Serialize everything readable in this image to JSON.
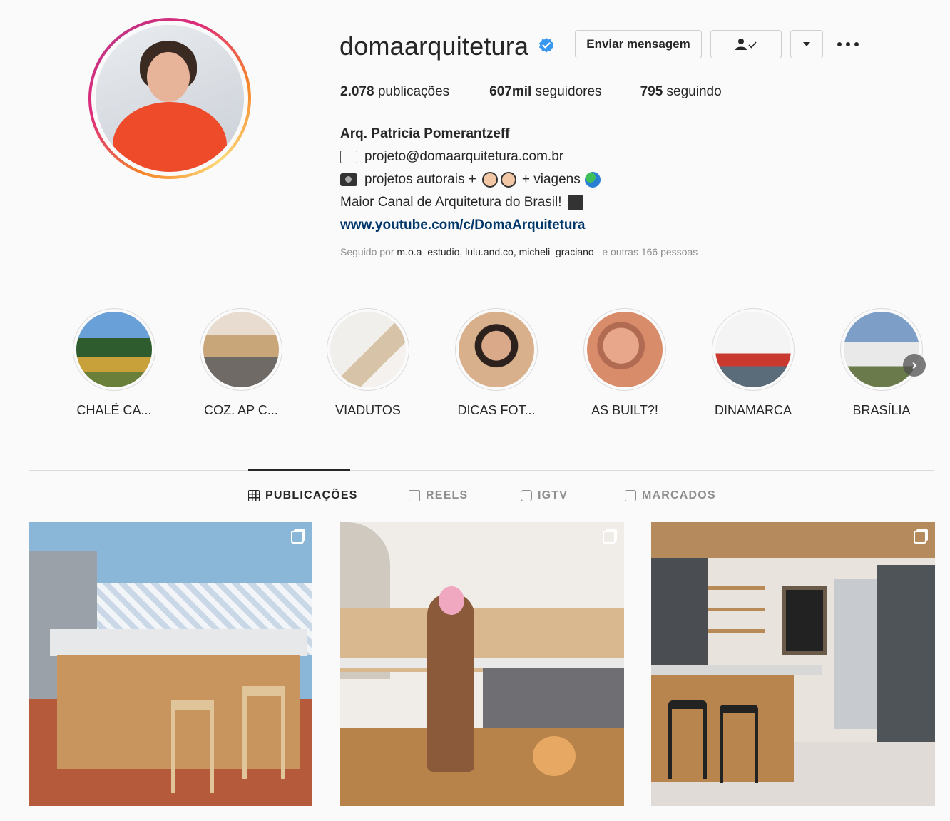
{
  "profile": {
    "username": "domaarquitetura",
    "verified": true,
    "buttons": {
      "message": "Enviar mensagem",
      "following_icon": "person-check-icon",
      "dropdown_icon": "chevron-down-icon",
      "more_icon": "more-options-icon"
    },
    "stats": {
      "posts_value": "2.078",
      "posts_label": "publicações",
      "followers_value": "607mil",
      "followers_label": "seguidores",
      "following_value": "795",
      "following_label": "seguindo"
    },
    "bio": {
      "name": "Arq. Patricia Pomerantzeff",
      "email": "projeto@domaarquitetura.com.br",
      "line2_a": "projetos autorais +",
      "line2_b": "+ viagens",
      "line3": "Maior Canal de Arquitetura do Brasil!",
      "link": "www.youtube.com/c/DomaArquitetura"
    },
    "followed_by": {
      "prefix": "Seguido por",
      "users": "m.o.a_estudio, lulu.and.co, micheli_graciano_",
      "suffix": "e outras 166 pessoas"
    }
  },
  "highlights": [
    {
      "label": "CHALÉ CA...",
      "color": "#3a6b3a"
    },
    {
      "label": "COZ. AP C...",
      "color": "#c9a57a"
    },
    {
      "label": "VIADUTOS",
      "color": "#e9e6e2"
    },
    {
      "label": "DICAS FOT...",
      "color": "#d9b08c"
    },
    {
      "label": "AS BUILT?!",
      "color": "#d98c6a"
    },
    {
      "label": "DINAMARCA",
      "color": "#c9392f"
    },
    {
      "label": "BRASÍLIA",
      "color": "#8aa6c8"
    }
  ],
  "tabs": [
    {
      "label": "PUBLICAÇÕES",
      "icon": "grid-icon",
      "active": true
    },
    {
      "label": "REELS",
      "icon": "reels-icon",
      "active": false
    },
    {
      "label": "IGTV",
      "icon": "igtv-icon",
      "active": false
    },
    {
      "label": "MARCADOS",
      "icon": "tagged-icon",
      "active": false
    }
  ],
  "posts": [
    {
      "type": "carousel",
      "icon": "multiple-photos-icon"
    },
    {
      "type": "carousel",
      "icon": "multiple-photos-icon"
    },
    {
      "type": "carousel",
      "icon": "multiple-photos-icon"
    }
  ]
}
